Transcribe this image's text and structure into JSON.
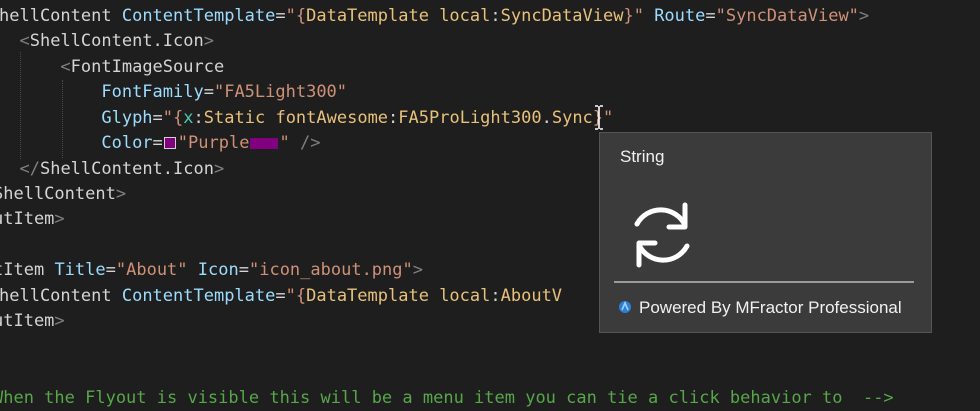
{
  "editor": {
    "lines": [
      {
        "tokens": [
          {
            "t": "hellContent",
            "c": "tk-tag"
          },
          {
            "t": " ",
            "c": ""
          },
          {
            "t": "ContentTemplate",
            "c": "tk-attr"
          },
          {
            "t": "=",
            "c": "tk-eq"
          },
          {
            "t": "\"{",
            "c": "tk-strq"
          },
          {
            "t": "DataTemplate",
            "c": "tk-mk"
          },
          {
            "t": " ",
            "c": ""
          },
          {
            "t": "local",
            "c": "tk-ns"
          },
          {
            "t": ":",
            "c": "tk-colon"
          },
          {
            "t": "SyncDataView",
            "c": "tk-cls"
          },
          {
            "t": "}\"",
            "c": "tk-strq"
          },
          {
            "t": " ",
            "c": ""
          },
          {
            "t": "Route",
            "c": "tk-attr"
          },
          {
            "t": "=",
            "c": "tk-eq"
          },
          {
            "t": "\"SyncDataView\"",
            "c": "tk-str"
          },
          {
            "t": ">",
            "c": "tk-br"
          }
        ]
      },
      {
        "tokens": [
          {
            "t": "  ",
            "c": ""
          },
          {
            "t": "<",
            "c": "tk-br"
          },
          {
            "t": "ShellContent.Icon",
            "c": "tk-tag"
          },
          {
            "t": ">",
            "c": "tk-br"
          }
        ]
      },
      {
        "tokens": [
          {
            "t": "      ",
            "c": ""
          },
          {
            "t": "<",
            "c": "tk-br"
          },
          {
            "t": "FontImageSource",
            "c": "tk-tag"
          }
        ]
      },
      {
        "tokens": [
          {
            "t": "          ",
            "c": ""
          },
          {
            "t": "FontFamily",
            "c": "tk-attr"
          },
          {
            "t": "=",
            "c": "tk-eq"
          },
          {
            "t": "\"FA5Light300\"",
            "c": "tk-str"
          }
        ]
      },
      {
        "tokens": [
          {
            "t": "          ",
            "c": ""
          },
          {
            "t": "Glyph",
            "c": "tk-attr"
          },
          {
            "t": "=",
            "c": "tk-eq"
          },
          {
            "t": "\"{",
            "c": "tk-strq"
          },
          {
            "t": "x",
            "c": "tk-x"
          },
          {
            "t": ":",
            "c": "tk-colon"
          },
          {
            "t": "Static",
            "c": "tk-mk"
          },
          {
            "t": " ",
            "c": ""
          },
          {
            "t": "fontAwesome",
            "c": "tk-ns"
          },
          {
            "t": ":",
            "c": "tk-colon"
          },
          {
            "t": "FA5ProLight300",
            "c": "tk-cls"
          },
          {
            "t": ".",
            "c": "tk-colon"
          },
          {
            "t": "Sync",
            "c": "tk-cls"
          },
          {
            "t": "}\"",
            "c": "tk-strq"
          }
        ]
      },
      {
        "tokens": [
          {
            "t": "          ",
            "c": ""
          },
          {
            "t": "Color",
            "c": "tk-attr"
          },
          {
            "t": "=",
            "c": "tk-eq"
          },
          {
            "t": "SWATCH",
            "c": "swatch"
          },
          {
            "t": "\"Purple",
            "c": "tk-str"
          },
          {
            "t": "ADORN",
            "c": "adorn"
          },
          {
            "t": "\"",
            "c": "tk-str"
          },
          {
            "t": " ",
            "c": ""
          },
          {
            "t": "/>",
            "c": "tk-br"
          }
        ]
      },
      {
        "tokens": [
          {
            "t": "  ",
            "c": ""
          },
          {
            "t": "</",
            "c": "tk-br"
          },
          {
            "t": "ShellContent.Icon",
            "c": "tk-tag"
          },
          {
            "t": ">",
            "c": "tk-br"
          }
        ]
      },
      {
        "tokens": [
          {
            "t": "ShellContent",
            "c": "tk-tag"
          },
          {
            "t": ">",
            "c": "tk-br"
          }
        ]
      },
      {
        "tokens": [
          {
            "t": "utItem",
            "c": "tk-tag"
          },
          {
            "t": ">",
            "c": "tk-br"
          }
        ]
      },
      {
        "tokens": []
      },
      {
        "tokens": [
          {
            "t": "tItem",
            "c": "tk-tag"
          },
          {
            "t": " ",
            "c": ""
          },
          {
            "t": "Title",
            "c": "tk-attr"
          },
          {
            "t": "=",
            "c": "tk-eq"
          },
          {
            "t": "\"About\"",
            "c": "tk-str"
          },
          {
            "t": " ",
            "c": ""
          },
          {
            "t": "Icon",
            "c": "tk-attr"
          },
          {
            "t": "=",
            "c": "tk-eq"
          },
          {
            "t": "\"icon_about.png\"",
            "c": "tk-str"
          },
          {
            "t": ">",
            "c": "tk-br"
          }
        ]
      },
      {
        "tokens": [
          {
            "t": "hellContent",
            "c": "tk-tag"
          },
          {
            "t": " ",
            "c": ""
          },
          {
            "t": "ContentTemplate",
            "c": "tk-attr"
          },
          {
            "t": "=",
            "c": "tk-eq"
          },
          {
            "t": "\"{",
            "c": "tk-strq"
          },
          {
            "t": "DataTemplate",
            "c": "tk-mk"
          },
          {
            "t": " ",
            "c": ""
          },
          {
            "t": "local",
            "c": "tk-ns"
          },
          {
            "t": ":",
            "c": "tk-colon"
          },
          {
            "t": "AboutV",
            "c": "tk-cls"
          }
        ]
      },
      {
        "tokens": [
          {
            "t": "utItem",
            "c": "tk-tag"
          },
          {
            "t": ">",
            "c": "tk-br"
          }
        ]
      },
      {
        "tokens": []
      },
      {
        "tokens": []
      },
      {
        "tokens": [
          {
            "t": "When the Flyout is visible this will be a menu item you can tie a click behavior to  -->",
            "c": "tk-com"
          }
        ]
      }
    ],
    "swatch_color": "#800080",
    "adorn_color": "#800080"
  },
  "tooltip": {
    "title": "String",
    "glyph_icon": "sync-icon",
    "powered_by": "Powered By MFractor Professional",
    "logo_icon": "mfractor-logo-icon"
  }
}
